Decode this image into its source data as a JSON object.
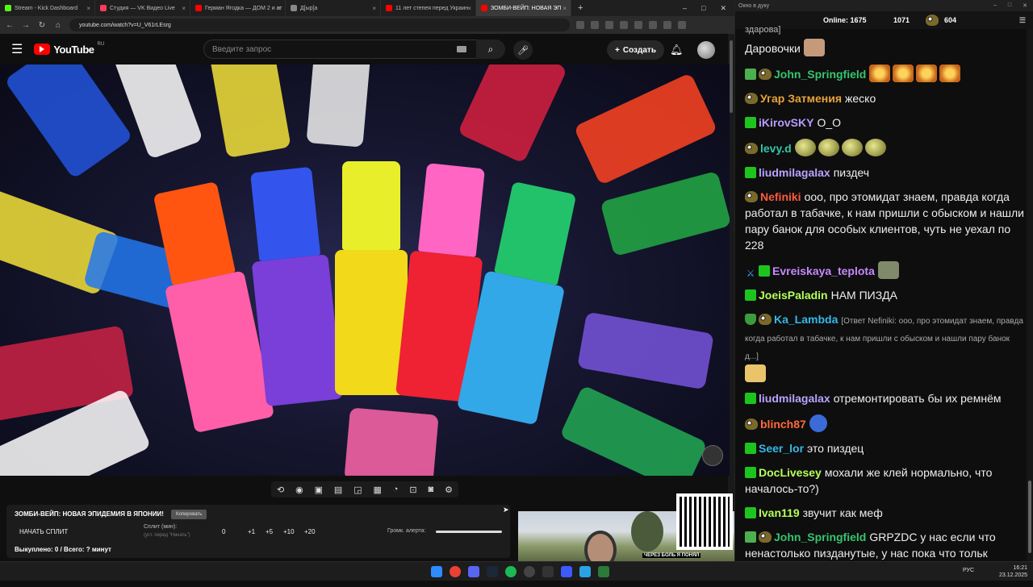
{
  "browser": {
    "tabs": [
      {
        "label": "Stream - Kick Dashboard",
        "color": "#53fc18"
      },
      {
        "label": "Студия — VK Видео Live",
        "color": "#ff3b5c"
      },
      {
        "label": "Герман Ягодка — ДОМ 2 и ат",
        "color": "#ff0000"
      },
      {
        "label": "Д[ыр]а",
        "color": "#888888"
      },
      {
        "label": "11 лет степея перед Украин",
        "color": "#ff0000"
      },
      {
        "label": "ЗОМБИ-ВЕЙП: НОВАЯ ЭП",
        "color": "#ff0000",
        "active": true
      }
    ],
    "new_tab": "+",
    "url": "youtube.com/watch?v=U_V61rLEsrg",
    "window_buttons": [
      "–",
      "□",
      "✕"
    ]
  },
  "youtube": {
    "logo_text": "YouTube",
    "region": "RU",
    "search_placeholder": "Введите запрос",
    "create_label": "Создать"
  },
  "panel": {
    "title": "ЗОМБИ-ВЕЙП: НОВАЯ ЭПИДЕМИЯ В ЯПОНИИ!",
    "copy_label": "Копировать",
    "start_split": "НАЧАТЬ СПЛИТ",
    "split_label": "Сплит (мин):",
    "split_hint": "(уст. перед \"Начать\")",
    "split_value": "0",
    "steps": [
      "+1",
      "+5",
      "+10",
      "+20"
    ],
    "volume_label": "Громк. алерта:",
    "volume_level": 1.0,
    "stats": "Выкуплено: 0 / Всего: ? минут"
  },
  "cam": {
    "caption": "ЧЕРЕЗ БОЛЬ Я ПОНЯЛ"
  },
  "chat": {
    "window_title": "Окно в дуку",
    "online_label": "Online:",
    "online_count": "1675",
    "kick_count": "1071",
    "coin_count": "604",
    "messages": [
      {
        "user": "",
        "text": "здарова]",
        "partial": true
      },
      {
        "user": "",
        "text": "Даровочки",
        "emote": "face"
      },
      {
        "user": "John_Springfield",
        "color": "#35c56f",
        "badges": [
          "pencil",
          "pepe"
        ],
        "text": "",
        "emotes": [
          "burger",
          "burger",
          "burger",
          "burger"
        ]
      },
      {
        "user": "Угар Затмения",
        "color": "#e8a33c",
        "badges": [
          "pepe"
        ],
        "text": "жеско"
      },
      {
        "user": "iKirovSKY",
        "color": "#b89bff",
        "badges": [
          "kick"
        ],
        "text": "O_O"
      },
      {
        "user": "levy.d",
        "color": "#35c5a4",
        "badges": [
          "pepe"
        ],
        "text": "",
        "emotes": [
          "ball",
          "ball",
          "ball",
          "ball"
        ]
      },
      {
        "user": "liudmilagalax",
        "color": "#b9a3ff",
        "badges": [
          "kick"
        ],
        "text": "пиздеч"
      },
      {
        "user": "Nefiniki",
        "color": "#ff5a3c",
        "badges": [
          "pepe"
        ],
        "text": "ооо, про этомидат знаем, правда когда работал в табачке, к нам пришли с обыском и нашли пару банок для особых клиентов, чуть не уехал по 228"
      },
      {
        "user": "Evreiskaya_teplota",
        "color": "#c58aff",
        "badges": [
          "sword",
          "kick"
        ],
        "text": "",
        "emotes": [
          "trash"
        ]
      },
      {
        "user": "JoeisPaladin",
        "color": "#b7ff5a",
        "badges": [
          "kick"
        ],
        "text": "НАМ ПИЗДА"
      },
      {
        "user": "Ka_Lambda",
        "color": "#35b8e8",
        "badges": [
          "shield",
          "pepe"
        ],
        "reply": "[Ответ Nefiniki: ооо, про этомидат знаем, правда когда работал в табачке, к нам пришли с обыском и нашли пару банок д...]",
        "emotes": [
          "doge"
        ]
      },
      {
        "user": "liudmilagalax",
        "color": "#b9a3ff",
        "badges": [
          "kick"
        ],
        "text": "отремонтировать бы их ремнём"
      },
      {
        "user": "blinch87",
        "color": "#ff6a3c",
        "badges": [
          "pepe"
        ],
        "text": "",
        "emotes": [
          "pepe2"
        ]
      },
      {
        "user": "Seer_lor",
        "color": "#35b8e8",
        "badges": [
          "kick"
        ],
        "text": "это пиздец"
      },
      {
        "user": "DocLivesey",
        "color": "#b7ff5a",
        "badges": [
          "kick"
        ],
        "text": "мохали же клей нормально, что началось-то?)"
      },
      {
        "user": "Ivan119",
        "color": "#b7ff5a",
        "badges": [
          "kick"
        ],
        "text": "звучит как меф"
      },
      {
        "user": "John_Springfield",
        "color": "#35c56f",
        "badges": [
          "pencil",
          "pepe"
        ],
        "text": "GRPZDC у нас если что ненастолько пизданутые, у нас пока что тольк местный наркоз мешают",
        "emotes_after": [
          "man",
          "man",
          "man",
          "man"
        ]
      }
    ]
  },
  "taskbar": {
    "lang": "РУС",
    "time": "16:21",
    "date": "23.12.2025"
  }
}
